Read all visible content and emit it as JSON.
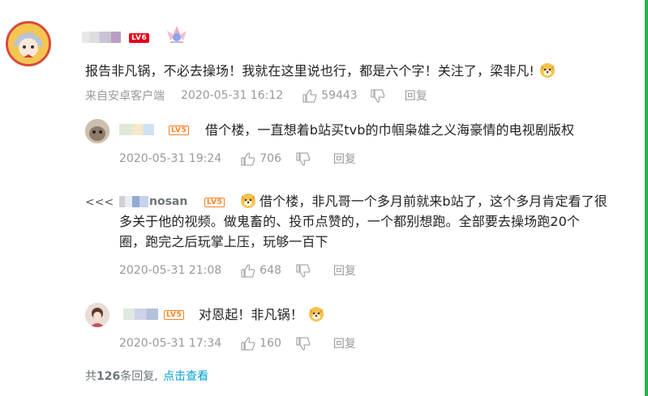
{
  "main_comment": {
    "level": "LV6",
    "text": "报告非凡锅，不必去操场！我就在这里说也行，都是六个字！关注了，梁非凡!",
    "source": "来自安卓客户端",
    "time": "2020-05-31 16:12",
    "likes": "59443",
    "reply_label": "回复"
  },
  "replies": [
    {
      "level": "LV5",
      "text": "借个楼，一直想着b站买tvb的巾帼枭雄之义海豪情的电视剧版权",
      "time": "2020-05-31 19:24",
      "likes": "706",
      "reply_label": "回复"
    },
    {
      "marker": "<<<",
      "name_visible": "nosan",
      "level": "LV5",
      "text_line1": "借个楼，非凡哥一个多月前就来b站了，这个多月肯定看了很",
      "text_line2": "多关于他的视频。做鬼畜的、投币点赞的，一个都别想跑。全部要去操场跑20个",
      "text_line3": "圈，跑完之后玩掌上压，玩够一百下",
      "time": "2020-05-31 21:08",
      "likes": "648",
      "reply_label": "回复"
    },
    {
      "level": "LV5",
      "text": "对恩起！非凡锅！",
      "time": "2020-05-31 17:34",
      "likes": "160",
      "reply_label": "回复"
    }
  ],
  "footer": {
    "prefix": "共",
    "count": "126",
    "suffix": "条回复,",
    "view_link": "点击查看"
  },
  "colors": {
    "accent_blue": "#00a1d6",
    "scrollbar": "#2bb24c",
    "meta_gray": "#999999"
  }
}
